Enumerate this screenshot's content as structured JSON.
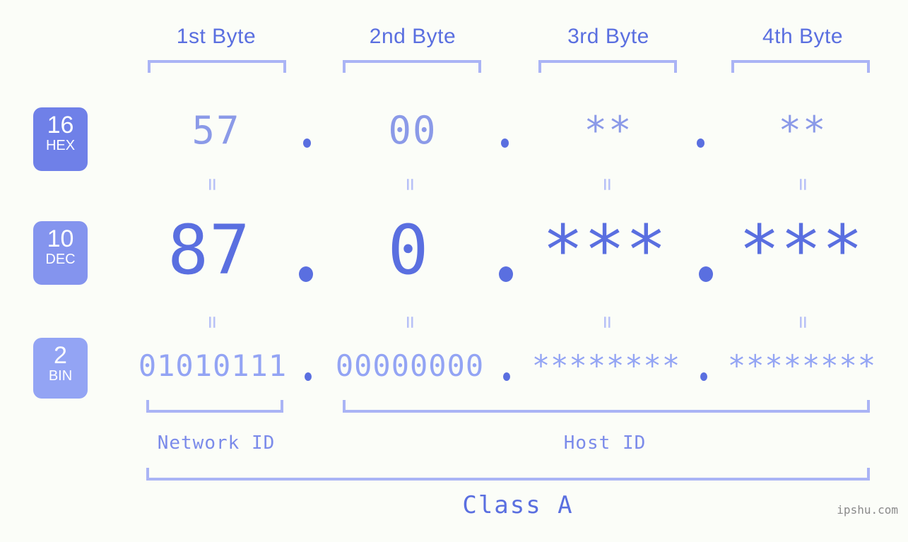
{
  "meta": {
    "watermark": "ipshu.com",
    "accent_dark": "#5a6fe0",
    "accent_mid": "#8b9ae8",
    "accent_light": "#aab4f5",
    "background": "#fbfdf8"
  },
  "byte_headers": [
    {
      "label": "1st Byte"
    },
    {
      "label": "2nd Byte"
    },
    {
      "label": "3rd Byte"
    },
    {
      "label": "4th Byte"
    }
  ],
  "bases": [
    {
      "id": "hex",
      "number": "16",
      "name": "HEX"
    },
    {
      "id": "dec",
      "number": "10",
      "name": "DEC"
    },
    {
      "id": "bin",
      "number": "2",
      "name": "BIN"
    }
  ],
  "rows": {
    "hex": {
      "bytes": [
        "57",
        "00",
        "**",
        "**"
      ],
      "separator": "."
    },
    "dec": {
      "bytes": [
        "87",
        "0",
        "***",
        "***"
      ],
      "separator": "."
    },
    "bin": {
      "bytes": [
        "01010111",
        "00000000",
        "********",
        "********"
      ],
      "separator": "."
    }
  },
  "equals": {
    "symbol": "=",
    "hex_to_dec": [
      "=",
      "=",
      "=",
      "="
    ],
    "dec_to_bin": [
      "=",
      "=",
      "=",
      "="
    ]
  },
  "sections": [
    {
      "id": "network",
      "label": "Network ID"
    },
    {
      "id": "host",
      "label": "Host ID"
    }
  ],
  "class": {
    "label": "Class A"
  }
}
